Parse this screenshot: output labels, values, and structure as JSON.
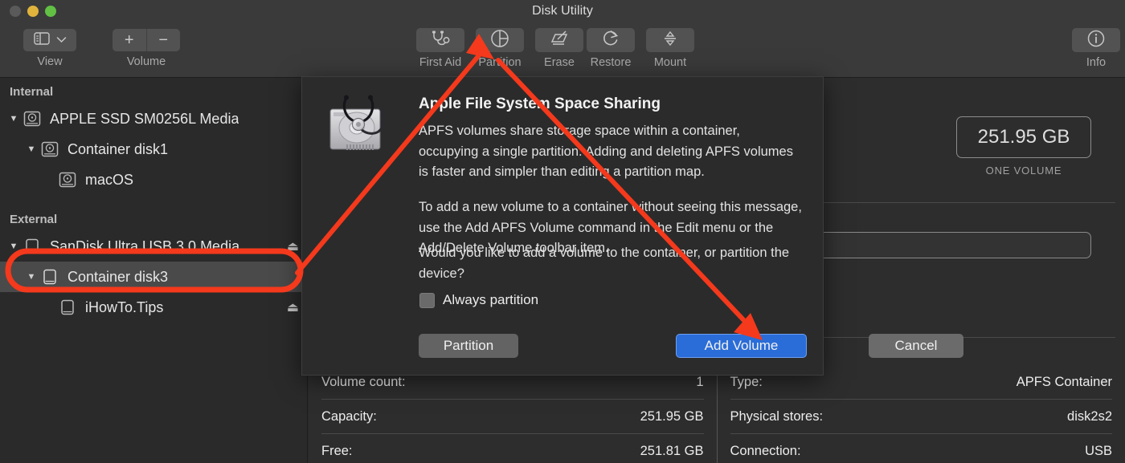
{
  "window": {
    "title": "Disk Utility",
    "traffic_lights": [
      "close",
      "minimize",
      "zoom"
    ]
  },
  "toolbar": {
    "view": {
      "label": "View",
      "icon": "sidebar-icon",
      "chevron": "chevron-down-icon"
    },
    "volume": {
      "label": "Volume",
      "add": "+",
      "remove": "−"
    },
    "items": [
      {
        "label": "First Aid",
        "icon": "stethoscope-icon"
      },
      {
        "label": "Partition",
        "icon": "pie-chart-icon"
      },
      {
        "label": "Erase",
        "icon": "erase-icon"
      },
      {
        "label": "Restore",
        "icon": "restore-arrow-icon"
      },
      {
        "label": "Mount",
        "icon": "mount-arrows-icon"
      }
    ],
    "info": {
      "label": "Info",
      "icon": "info-circle-icon"
    }
  },
  "sidebar": {
    "groups": [
      {
        "label": "Internal",
        "items": [
          {
            "label": "APPLE SSD SM0256L Media",
            "indent": 0,
            "disclosure": "▼",
            "icon": "internal-disk-icon",
            "selected": false,
            "eject": false
          },
          {
            "label": "Container disk1",
            "indent": 1,
            "disclosure": "▼",
            "icon": "internal-disk-icon",
            "selected": false,
            "eject": false
          },
          {
            "label": "macOS",
            "indent": 2,
            "disclosure": "",
            "icon": "internal-disk-icon",
            "selected": false,
            "eject": false
          }
        ]
      },
      {
        "label": "External",
        "items": [
          {
            "label": "SanDisk Ultra USB 3.0 Media",
            "indent": 0,
            "disclosure": "▼",
            "icon": "external-disk-icon",
            "selected": false,
            "eject": true
          },
          {
            "label": "Container disk3",
            "indent": 1,
            "disclosure": "▼",
            "icon": "external-disk-icon",
            "selected": true,
            "eject": false
          },
          {
            "label": "iHowTo.Tips",
            "indent": 2,
            "disclosure": "",
            "icon": "external-disk-icon",
            "selected": false,
            "eject": true
          }
        ]
      }
    ],
    "eject_glyph": "⏏"
  },
  "content": {
    "capacity_badge": "251.95 GB",
    "capacity_caption": "ONE VOLUME"
  },
  "info_table": {
    "left": [
      {
        "key": "Volume count:",
        "value": "1"
      },
      {
        "key": "Capacity:",
        "value": "251.95 GB"
      },
      {
        "key": "Free:",
        "value": "251.81 GB"
      }
    ],
    "right": [
      {
        "key": "Type:",
        "value": "APFS Container"
      },
      {
        "key": "Physical stores:",
        "value": "disk2s2"
      },
      {
        "key": "Connection:",
        "value": "USB"
      }
    ]
  },
  "dialog": {
    "icon": "hard-drive-stethoscope-icon",
    "title": "Apple File System Space Sharing",
    "paragraph1": "APFS volumes share storage space within a container, occupying a single partition. Adding and deleting APFS volumes is faster and simpler than editing a partition map.",
    "paragraph2": "To add a new volume to a container without seeing this message, use the Add APFS Volume command in the Edit menu or the Add/Delete Volume toolbar item.",
    "paragraph3": "Would you like to add a volume to the container, or partition the device?",
    "checkbox_label": "Always partition",
    "checkbox_checked": false,
    "buttons": {
      "partition": "Partition",
      "cancel": "Cancel",
      "add_volume": "Add Volume"
    },
    "default_button": "Add Volume"
  },
  "annotations": {
    "highlight_color": "#f4391c",
    "highlight_target": "Container disk3",
    "arrow1_target": "Partition",
    "arrow2_target": "Add Volume"
  }
}
